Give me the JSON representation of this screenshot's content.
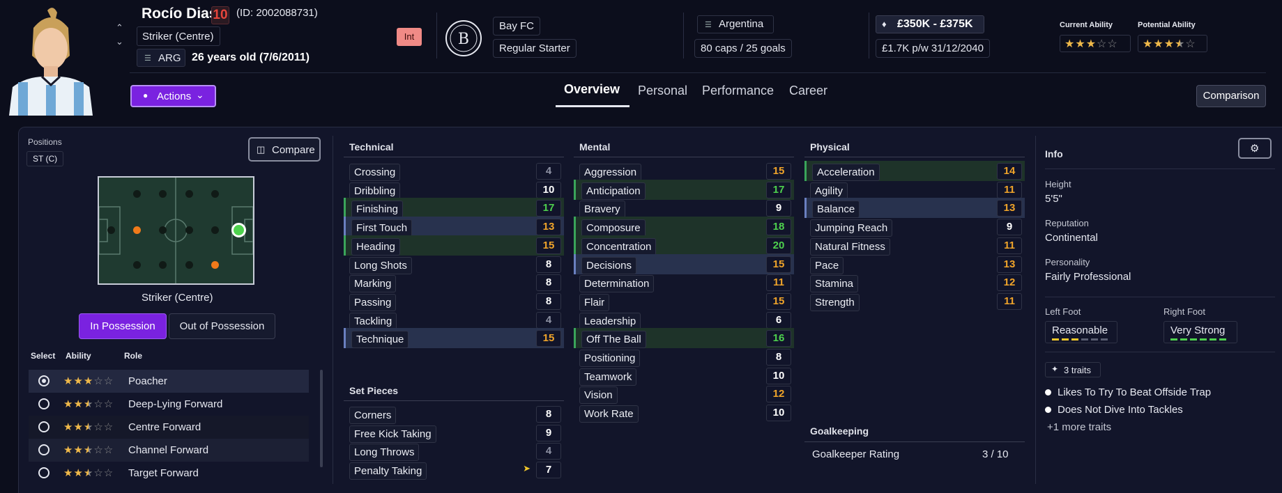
{
  "player": {
    "name": "Rocío Dias",
    "number": "10",
    "id_text": "(ID: 2002088731)",
    "position": "Striker (Centre)",
    "nation_code": "ARG",
    "age_text": "26 years old (7/6/2011)",
    "int_badge": "Int"
  },
  "club": {
    "name": "Bay FC",
    "status": "Regular Starter"
  },
  "nation": {
    "name": "Argentina",
    "caps": "80 caps / 25 goals"
  },
  "contract": {
    "value": "£350K - £375K",
    "wage": "£1.7K p/w 31/12/2040"
  },
  "ability": {
    "current_label": "Current Ability",
    "current_stars": 3,
    "potential_label": "Potential Ability",
    "potential_stars": 3.5
  },
  "actions_label": "Actions",
  "tabs": [
    "Overview",
    "Personal",
    "Performance",
    "Career"
  ],
  "comparison_label": "Comparison",
  "left": {
    "positions_label": "Positions",
    "position_badge": "ST (C)",
    "compare_label": "Compare",
    "pitch_caption": "Striker (Centre)",
    "in_possession": "In Possession",
    "out_possession": "Out of Possession",
    "col_select": "Select",
    "col_ability": "Ability",
    "col_role": "Role",
    "roles": [
      {
        "name": "Poacher",
        "stars": 3,
        "selected": true
      },
      {
        "name": "Deep-Lying Forward",
        "stars": 2.5,
        "selected": false
      },
      {
        "name": "Centre Forward",
        "stars": 2.5,
        "selected": false
      },
      {
        "name": "Channel Forward",
        "stars": 2.5,
        "selected": false
      },
      {
        "name": "Target Forward",
        "stars": 2.5,
        "selected": false
      }
    ]
  },
  "technical": {
    "title": "Technical",
    "attrs": [
      {
        "name": "Crossing",
        "value": "4"
      },
      {
        "name": "Dribbling",
        "value": "10"
      },
      {
        "name": "Finishing",
        "value": "17"
      },
      {
        "name": "First Touch",
        "value": "13"
      },
      {
        "name": "Heading",
        "value": "15"
      },
      {
        "name": "Long Shots",
        "value": "8"
      },
      {
        "name": "Marking",
        "value": "8"
      },
      {
        "name": "Passing",
        "value": "8"
      },
      {
        "name": "Tackling",
        "value": "4"
      },
      {
        "name": "Technique",
        "value": "15"
      }
    ]
  },
  "set_pieces": {
    "title": "Set Pieces",
    "attrs": [
      {
        "name": "Corners",
        "value": "8"
      },
      {
        "name": "Free Kick Taking",
        "value": "9"
      },
      {
        "name": "Long Throws",
        "value": "4"
      },
      {
        "name": "Penalty Taking",
        "value": "7"
      }
    ]
  },
  "mental": {
    "title": "Mental",
    "attrs": [
      {
        "name": "Aggression",
        "value": "15"
      },
      {
        "name": "Anticipation",
        "value": "17"
      },
      {
        "name": "Bravery",
        "value": "9"
      },
      {
        "name": "Composure",
        "value": "18"
      },
      {
        "name": "Concentration",
        "value": "20"
      },
      {
        "name": "Decisions",
        "value": "15"
      },
      {
        "name": "Determination",
        "value": "11"
      },
      {
        "name": "Flair",
        "value": "15"
      },
      {
        "name": "Leadership",
        "value": "6"
      },
      {
        "name": "Off The Ball",
        "value": "16"
      },
      {
        "name": "Positioning",
        "value": "8"
      },
      {
        "name": "Teamwork",
        "value": "10"
      },
      {
        "name": "Vision",
        "value": "12"
      },
      {
        "name": "Work Rate",
        "value": "10"
      }
    ]
  },
  "physical": {
    "title": "Physical",
    "attrs": [
      {
        "name": "Acceleration",
        "value": "14"
      },
      {
        "name": "Agility",
        "value": "11"
      },
      {
        "name": "Balance",
        "value": "13"
      },
      {
        "name": "Jumping Reach",
        "value": "9"
      },
      {
        "name": "Natural Fitness",
        "value": "11"
      },
      {
        "name": "Pace",
        "value": "13"
      },
      {
        "name": "Stamina",
        "value": "12"
      },
      {
        "name": "Strength",
        "value": "11"
      }
    ]
  },
  "goalkeeping": {
    "title": "Goalkeeping",
    "rating_label": "Goalkeeper Rating",
    "rating_value": "3 / 10"
  },
  "info": {
    "title": "Info",
    "height_label": "Height",
    "height": "5'5\"",
    "reputation_label": "Reputation",
    "reputation": "Continental",
    "personality_label": "Personality",
    "personality": "Fairly Professional",
    "left_foot_label": "Left Foot",
    "left_foot": "Reasonable",
    "right_foot_label": "Right Foot",
    "right_foot": "Very Strong",
    "traits_badge": "3 traits",
    "traits": [
      "Likes To Try To Beat Offside Trap",
      "Does Not Dive Into Tackles"
    ],
    "more_traits": "+1 more traits"
  },
  "colors": {
    "accent": "#7a22e0",
    "green": "#4ed14e",
    "orange": "#f0a42a",
    "grey": "#8e92a4"
  }
}
